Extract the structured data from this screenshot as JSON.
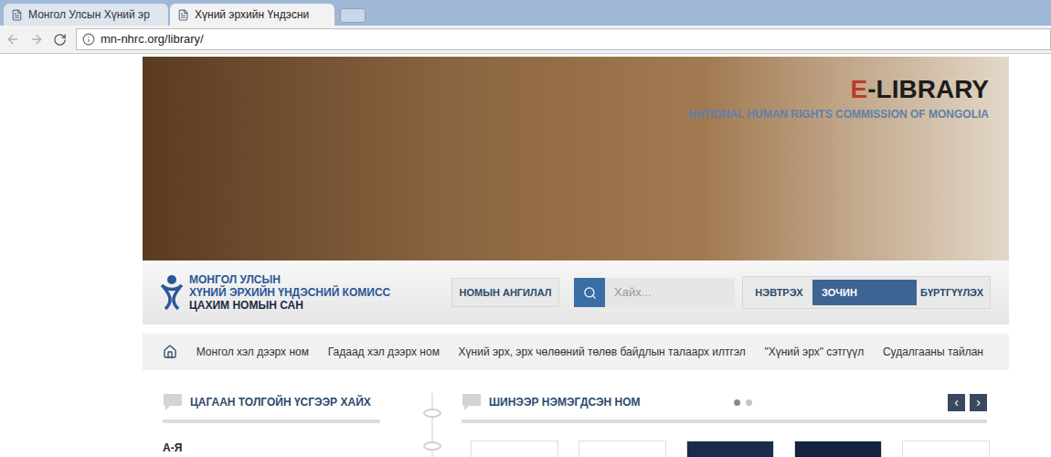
{
  "browser": {
    "tabs": [
      {
        "title": "Монгол Улсын Хүний эр",
        "selected": false
      },
      {
        "title": "Хүний эрхийн Үндэсни",
        "selected": true
      }
    ],
    "url": "mn-nhrc.org/library/"
  },
  "banner": {
    "title": [
      {
        "text": "E",
        "color": "#c0392b"
      },
      {
        "text": "-LIBRARY",
        "color": "#1c1c1c"
      }
    ],
    "subtitle": "NATIONAL HUMAN RIGHTS COMMISSION OF MONGOLIA"
  },
  "logo": {
    "lines": [
      "МОНГОЛ УЛСЫН",
      "ХҮНИЙ ЭРХИЙН ҮНДЭСНИЙ КОМИСС",
      "ЦАХИМ НОМЫН САН"
    ]
  },
  "category_button": "НОМЫН АНГИЛАЛ",
  "search": {
    "placeholder": "Хайх..."
  },
  "user_buttons": [
    {
      "label": "НЭВТРЭХ",
      "selected": false
    },
    {
      "label": "ЗОЧИН",
      "selected": true
    },
    {
      "label": "БҮРТГҮҮЛЭХ",
      "selected": false
    }
  ],
  "nav": {
    "items": [
      "Монгол хэл дээрх ном",
      "Гадаад хэл дээрх ном",
      "Хүний эрх, эрх чөлөөний төлөв байдлын талаарх илтгэл",
      "\"Хүний эрх\" сэтгүүл",
      "Судалгааны тайлан"
    ]
  },
  "alphabet_panel": {
    "title": "ЦАГААН ТОЛГОЙН ҮСГЭЭР ХАЙХ",
    "items": [
      "А-Я"
    ]
  },
  "new_books": {
    "title": "ШИНЭЭР НЭМЭГДСЭН НОМ",
    "pages": [
      {
        "selected": true
      },
      {
        "selected": false
      }
    ],
    "prev": "‹",
    "next": "›",
    "books": [
      {
        "color": "#ffffff"
      },
      {
        "color": "#ffffff"
      },
      {
        "color": "#1c2b4d"
      },
      {
        "color": "#15233f"
      },
      {
        "color": "#ffffff"
      }
    ]
  }
}
